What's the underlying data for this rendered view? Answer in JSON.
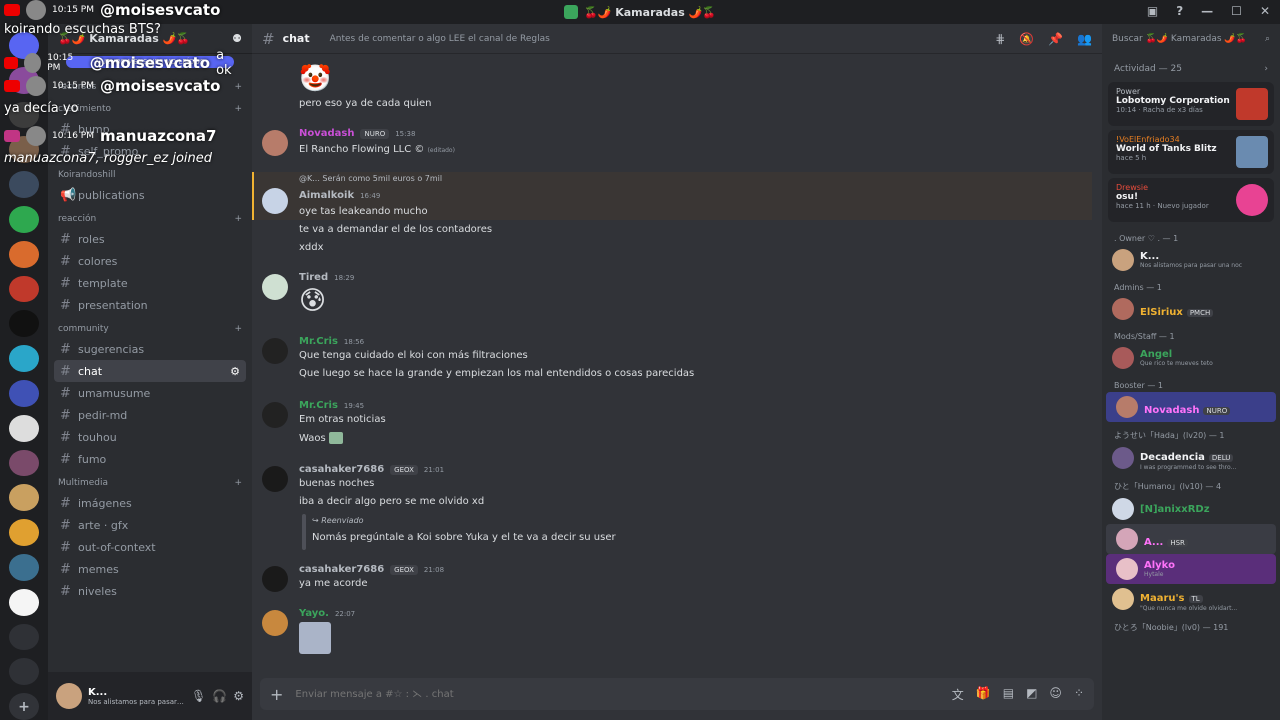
{
  "titlebar": {
    "title": "🍒🌶️ Kamaradas 🌶️🍒"
  },
  "server": {
    "name": "🍒🌶️ Kamaradas 🌶️🍒",
    "new_messages": "NUEVOS MENSAJES NO LEÍDOS"
  },
  "sidebar": {
    "cat_resources": "recursos",
    "cat_growth": "crecimiento",
    "ch_bump": "bump",
    "ch_self_promo": "self_promo",
    "cat_koirando": "Koirandoshill",
    "ch_publications": "publications",
    "cat_reaction": "reacción",
    "ch_roles": "roles",
    "ch_colores": "colores",
    "ch_template": "template",
    "ch_presentation": "presentation",
    "cat_community": "community",
    "ch_sugerencias": "sugerencias",
    "ch_chat": "chat",
    "ch_umamusume": "umamusume",
    "ch_pedirmd": "pedir-md",
    "ch_touhou": "touhou",
    "ch_fumo": "fumo",
    "cat_multimedia": "Multimedia",
    "ch_imagenes": "imágenes",
    "ch_arte": "arte · gfx",
    "ch_ooc": "out-of-context",
    "ch_memes": "memes",
    "ch_niveles": "niveles"
  },
  "user": {
    "name": "K...",
    "status": "Nos alistamos para pasar una noc"
  },
  "chat": {
    "channel": "chat",
    "topic": "Antes de comentar o algo LEE el canal de Reglas",
    "placeholder": "Enviar mensaje a #☆ : ⋋ . chat",
    "messages": {
      "m0": {
        "line1": "pero eso ya de cada quien"
      },
      "m1": {
        "author": "Novadash",
        "badge": "NURO",
        "time": "15:38",
        "line1": "El Rancho Flowing LLC ©",
        "edited": "(editado)"
      },
      "m2": {
        "reply": "@K... Serán como 5mil euros o 7mil",
        "author": "Aimalkoik",
        "time": "16:49",
        "line1": "oye tas leakeando mucho",
        "line2": "te va a demandar el de los contadores",
        "line3": "xddx"
      },
      "m3": {
        "author": "Tired",
        "time": "18:29",
        "emoji": "😰"
      },
      "m4": {
        "author": "Mr.Cris",
        "time": "18:56",
        "line1": "Que tenga cuidado el koi con más filtraciones",
        "line2": "Que luego se hace la grande y empiezan los mal entendidos o   cosas parecidas"
      },
      "m5": {
        "author": "Mr.Cris",
        "time": "19:45",
        "line1": "Em otras noticias",
        "line2": "Waos"
      },
      "m6": {
        "author": "casahaker7686",
        "badge": "GEOX",
        "time": "21:01",
        "line1": "buenas noches",
        "line2": "iba a decir algo pero se me olvido xd",
        "fwd_label": "Reenviado",
        "fwd_text": "Nomás pregúntale a Koi sobre Yuka y el te va a decir su user"
      },
      "m7": {
        "author": "casahaker7686",
        "badge": "GEOX",
        "time": "21:08",
        "line1": "ya me acorde"
      },
      "m8": {
        "author": "Yayo.",
        "time": "22:07"
      }
    }
  },
  "members": {
    "search": "Buscar 🍒🌶️ Kamaradas 🌶️🍒",
    "activity_title": "Actividad — 25",
    "activities": [
      {
        "user": "Power",
        "game": "Lobotomy Corporation",
        "detail": "10:14 · Racha de x3 días"
      },
      {
        "user": "!VoElEnfriado34",
        "game": "World of Tanks Blitz",
        "detail": "hace 5 h"
      },
      {
        "user": "Drewsie",
        "game": "osu!",
        "detail": "hace 11 h · Nuevo jugador"
      }
    ],
    "groups": {
      "owner": ". Owner ♡ . — 1",
      "admins": "Admins — 1",
      "mods": "Mods/Staff — 1",
      "booster": "Booster — 1",
      "hada": "ようせい「Hada」(lv20) — 1",
      "humano": "ひと「Humano」(lv10) — 4",
      "noobie": "ひとろ「Noobie」(lv0) — 191"
    },
    "list": {
      "owner": {
        "name": "K...",
        "status": "Nos alistamos para pasar una noc"
      },
      "admin": {
        "name": "ElSiriux",
        "badge": "PMCH"
      },
      "mod": {
        "name": "Angel",
        "status": "Que rico te mueves teto"
      },
      "booster": {
        "name": "Novadash",
        "badge": "NURO"
      },
      "hada": {
        "name": "Decadencia",
        "badge": "DELU",
        "status": "I was programmed to see thro..."
      },
      "h1": {
        "name": "[N]anixxRDz"
      },
      "h2": {
        "name": "A...",
        "badge": "HSR"
      },
      "h3": {
        "name": "Alyko",
        "status": "Hytale"
      },
      "h4": {
        "name": "Maaru's",
        "badge": "TL",
        "status": "\"Que nunca me olvide olvidart..."
      }
    }
  },
  "overlay": {
    "rows": [
      {
        "time": "10:15 PM",
        "user": "@moisesvcato"
      },
      {
        "time": "10:15 PM",
        "user": "@moisesvcato"
      },
      {
        "time": "10:15 PM",
        "user": "@moisesvcato"
      },
      {
        "time": "10:16 PM",
        "user": "manuazcona7"
      }
    ],
    "text1": "koirando escuchas BTS?",
    "text2": "a ok",
    "text3": "ya decía yo",
    "text4": "manuazcona7, rogger_ez joined"
  },
  "colors": {
    "accent": "#5865f2",
    "mention_bg": "#3a3634",
    "mention_bar": "#f0b232"
  }
}
